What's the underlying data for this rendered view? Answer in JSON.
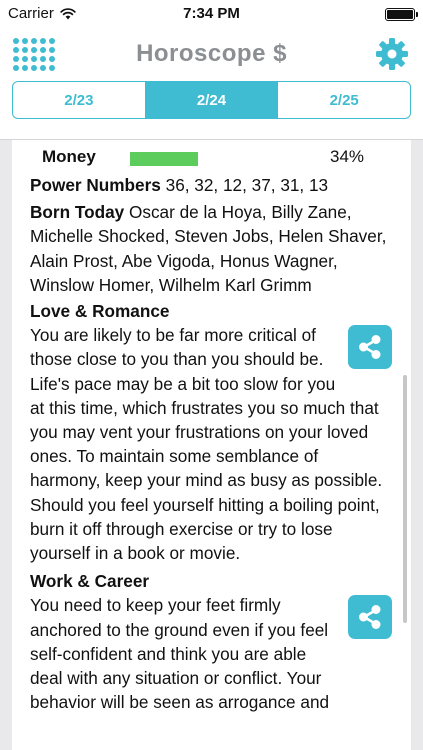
{
  "status_bar": {
    "carrier": "Carrier",
    "time": "7:34 PM"
  },
  "nav": {
    "title": "Horoscope $",
    "menu_icon": "grid-dots-icon",
    "settings_icon": "gear-icon"
  },
  "dates": [
    {
      "label": "2/23",
      "active": false
    },
    {
      "label": "2/24",
      "active": true
    },
    {
      "label": "2/25",
      "active": false
    }
  ],
  "money": {
    "label": "Money",
    "percent_text": "34%",
    "percent_value": 0.34
  },
  "power_numbers": {
    "label": "Power Numbers",
    "value": "36, 32, 12, 37, 31, 13"
  },
  "born_today": {
    "label": "Born Today",
    "value": "Oscar de la Hoya, Billy Zane, Michelle Shocked, Steven Jobs, Helen Shaver, Alain Prost, Abe Vigoda, Honus Wagner, Winslow Homer, Wilhelm Karl Grimm"
  },
  "love": {
    "title": "Love & Romance",
    "text": "You are likely to be far more critical of those close to you than you should be. Life's pace may be a bit too slow for you at this time, which frustrates you so much that you may vent your frustrations on your loved ones. To maintain some semblance of harmony, keep your mind as busy as possible. Should you feel yourself hitting a boiling point, burn it off through exercise or try to lose yourself in a book or movie."
  },
  "work": {
    "title": "Work & Career",
    "text": "You need to keep your feet firmly anchored to the ground even if you feel self-confident and think you are able deal with any situation or conflict. Your behavior will be seen as arrogance and"
  },
  "colors": {
    "accent": "#3fbcd1",
    "money_bar": "#5ccc5d",
    "title_gray": "#8b8f93"
  }
}
